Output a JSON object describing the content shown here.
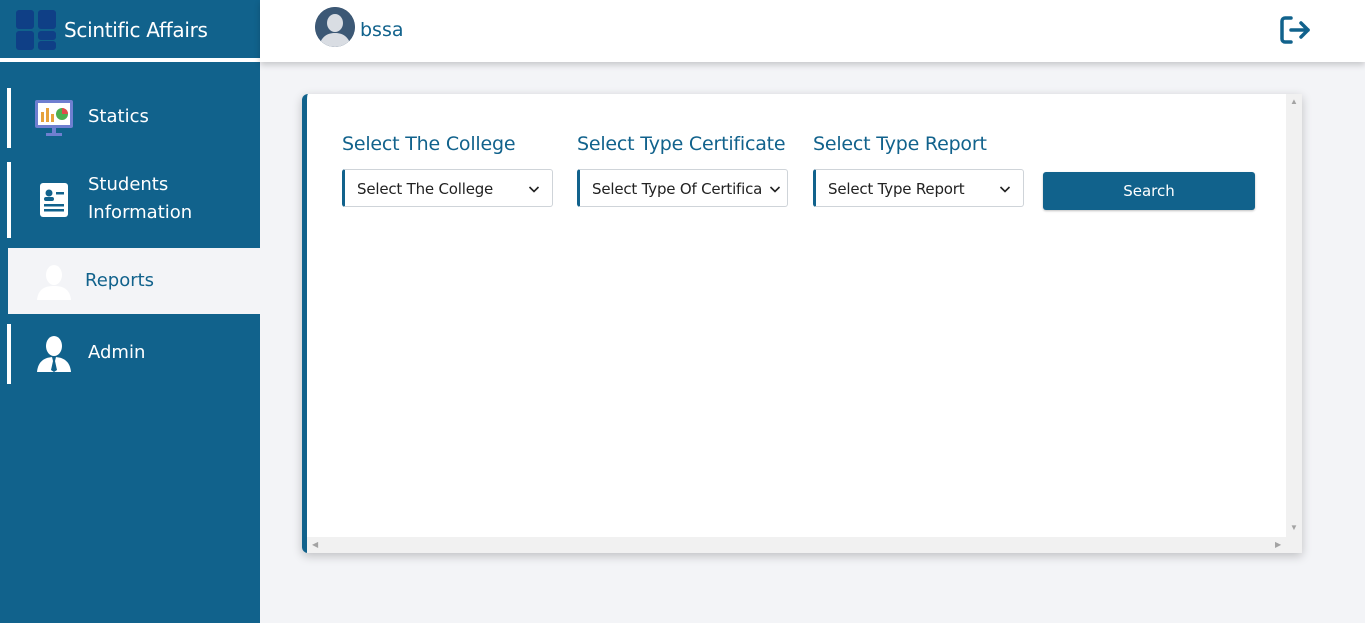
{
  "brand": {
    "title": "Scintific Affairs"
  },
  "sidebar": {
    "items": [
      {
        "label": "Statics",
        "icon": "presentation-chart-icon"
      },
      {
        "label": "Students Information",
        "line1": "Students",
        "line2": "Information",
        "icon": "id-card-icon"
      },
      {
        "label": "Reports",
        "icon": "user-silhouette-icon",
        "active": true
      },
      {
        "label": "Admin",
        "icon": "user-suit-icon"
      }
    ]
  },
  "topbar": {
    "username": "bssa",
    "avatar_icon": "user-avatar-icon",
    "logout_icon": "logout-icon"
  },
  "filters": {
    "college": {
      "label": "Select The College",
      "value": "Select The College"
    },
    "certificate": {
      "label": "Select Type Certificate",
      "value": "Select Type Of Certificate"
    },
    "report": {
      "label": "Select Type Report",
      "value": "Select Type Report"
    },
    "search_label": "Search"
  },
  "colors": {
    "primary": "#11628c",
    "background": "#f3f4f7",
    "logo": "#0f3f86"
  }
}
